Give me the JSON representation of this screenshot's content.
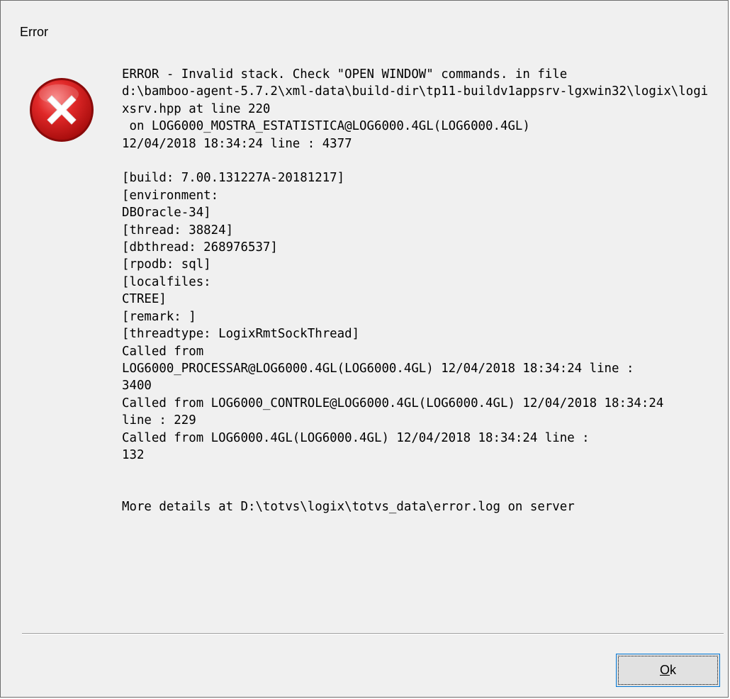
{
  "window": {
    "title": "Error"
  },
  "icon": {
    "name": "error-icon",
    "color": "#d41f1f"
  },
  "message": {
    "lines": [
      "ERROR - Invalid stack. Check \"OPEN WINDOW\" commands. in file",
      "d:\\bamboo-agent-5.7.2\\xml-data\\build-dir\\tp11-buildv1appsrv-lgxwin32\\logix\\logi",
      "xsrv.hpp at line 220",
      " on LOG6000_MOSTRA_ESTATISTICA@LOG6000.4GL(LOG6000.4GL)",
      "12/04/2018 18:34:24 line : 4377",
      "",
      "[build: 7.00.131227A-20181217]",
      "[environment:",
      "DBOracle-34]",
      "[thread: 38824]",
      "[dbthread: 268976537]",
      "[rpodb: sql]",
      "[localfiles:",
      "CTREE]",
      "[remark: ]",
      "[threadtype: LogixRmtSockThread]",
      "Called from",
      "LOG6000_PROCESSAR@LOG6000.4GL(LOG6000.4GL) 12/04/2018 18:34:24 line :",
      "3400",
      "Called from LOG6000_CONTROLE@LOG6000.4GL(LOG6000.4GL) 12/04/2018 18:34:24",
      "line : 229",
      "Called from LOG6000.4GL(LOG6000.4GL) 12/04/2018 18:34:24 line :",
      "132",
      "",
      "",
      "More details at D:\\totvs\\logix\\totvs_data\\error.log on server"
    ]
  },
  "buttons": {
    "ok_label": "Ok",
    "ok_mnemonic": "O"
  }
}
